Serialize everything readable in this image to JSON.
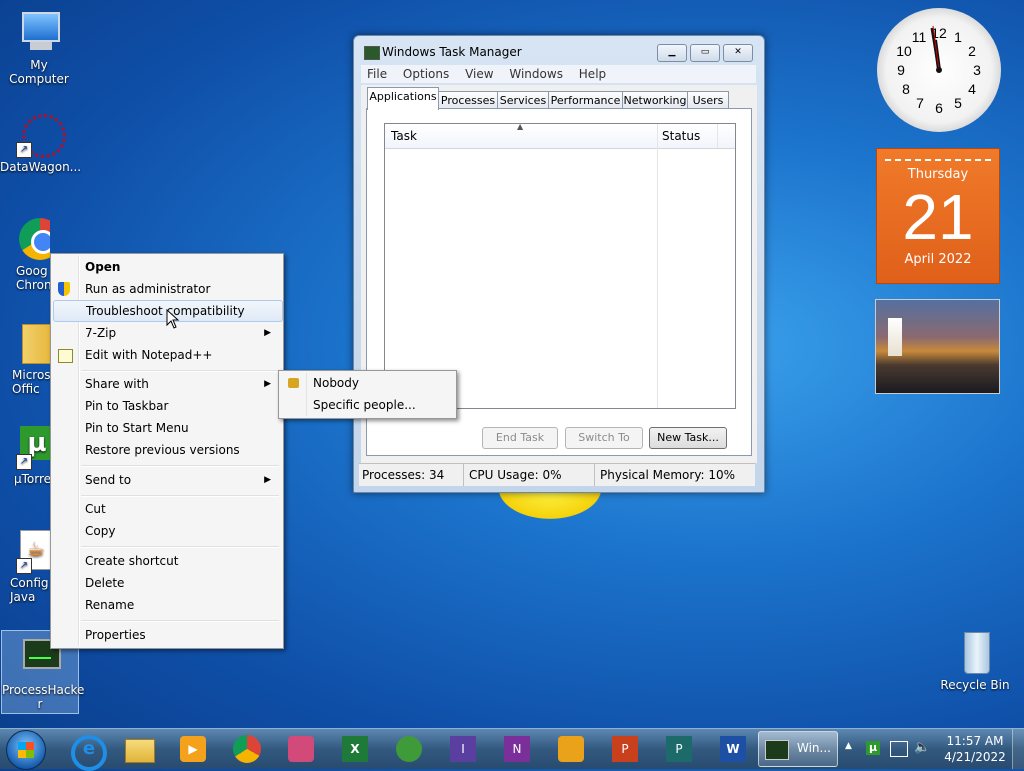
{
  "desktop": {
    "icons": [
      {
        "label": "My Computer"
      },
      {
        "label": "DataWagon..."
      },
      {
        "label": "Goog Chron"
      },
      {
        "label": "Micros Offic"
      },
      {
        "label": "µTorre"
      },
      {
        "label": "Config Java"
      },
      {
        "label": "ProcessHacke r"
      },
      {
        "label": "Recycle Bin"
      }
    ]
  },
  "gadgets": {
    "clock_numbers": [
      "12",
      "1",
      "2",
      "3",
      "4",
      "5",
      "6",
      "7",
      "8",
      "9",
      "10",
      "11"
    ],
    "calendar": {
      "weekday": "Thursday",
      "day": "21",
      "month_year": "April 2022"
    }
  },
  "task_manager": {
    "title": "Windows Task Manager",
    "menu": [
      "File",
      "Options",
      "View",
      "Windows",
      "Help"
    ],
    "tabs": [
      "Applications",
      "Processes",
      "Services",
      "Performance",
      "Networking",
      "Users"
    ],
    "columns": [
      "Task",
      "Status"
    ],
    "buttons": {
      "end_task": "End Task",
      "switch_to": "Switch To",
      "new_task": "New Task..."
    },
    "status": {
      "processes": "Processes: 34",
      "cpu": "CPU Usage: 0%",
      "memory": "Physical Memory: 10%"
    }
  },
  "context_menu": {
    "items": [
      {
        "label": "Open",
        "bold": true
      },
      {
        "label": "Run as administrator",
        "icon": "shield-icon"
      },
      {
        "label": "Troubleshoot compatibility"
      },
      {
        "label": "7-Zip",
        "submenu": true
      },
      {
        "label": "Edit with Notepad++",
        "icon": "notepad-icon"
      },
      {
        "label": "Share with",
        "submenu": true
      },
      {
        "label": "Pin to Taskbar"
      },
      {
        "label": "Pin to Start Menu"
      },
      {
        "label": "Restore previous versions"
      },
      {
        "label": "Send to",
        "submenu": true
      },
      {
        "label": "Cut"
      },
      {
        "label": "Copy"
      },
      {
        "label": "Create shortcut"
      },
      {
        "label": "Delete"
      },
      {
        "label": "Rename"
      },
      {
        "label": "Properties"
      }
    ]
  },
  "share_submenu": {
    "items": [
      "Nobody",
      "Specific people..."
    ]
  },
  "taskbar": {
    "active_window_label": "Win...",
    "time": "11:57 AM",
    "date": "4/21/2022"
  }
}
